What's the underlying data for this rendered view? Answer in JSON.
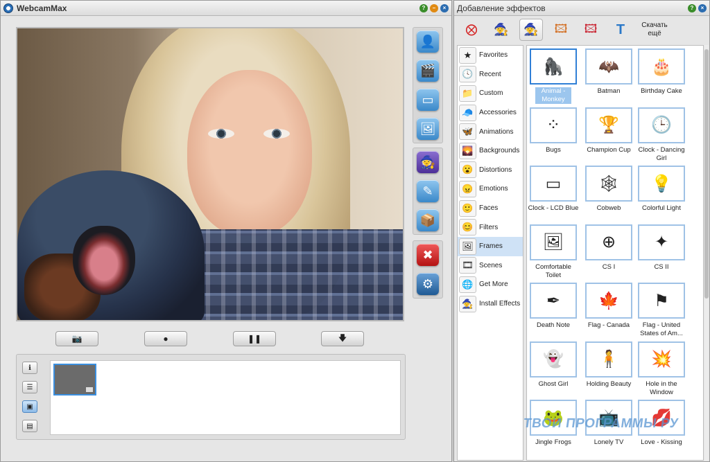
{
  "main_window": {
    "title": "WebcamMax",
    "controls": [
      "help-icon",
      "minimize-icon",
      "close-icon"
    ],
    "side_buttons": [
      {
        "name": "effects-button",
        "icon": "person-icon",
        "glyph": "👤"
      },
      {
        "name": "movie-button",
        "icon": "film-icon",
        "glyph": "🎬"
      },
      {
        "name": "screen-button",
        "icon": "window-icon",
        "glyph": "▭"
      },
      {
        "name": "picture-button",
        "icon": "picture-in-picture-icon",
        "glyph": "🖼"
      },
      {
        "name": "magic-button",
        "icon": "wizard-hat-icon",
        "glyph": "🧙"
      },
      {
        "name": "draw-button",
        "icon": "pencil-icon",
        "glyph": "✎"
      },
      {
        "name": "package-button",
        "icon": "box-icon",
        "glyph": "📦"
      },
      {
        "name": "disable-button",
        "icon": "red-x-icon",
        "glyph": "✖"
      },
      {
        "name": "settings-button",
        "icon": "gear-icon",
        "glyph": "⚙"
      }
    ],
    "control_buttons": [
      {
        "name": "snapshot-button",
        "icon": "camera-icon",
        "glyph": "📷"
      },
      {
        "name": "record-button",
        "icon": "record-dot-icon",
        "glyph": "●"
      },
      {
        "name": "pause-button",
        "icon": "pause-icon",
        "glyph": "❚❚"
      },
      {
        "name": "download-button",
        "icon": "down-arrow-icon",
        "glyph": "🡇"
      }
    ],
    "mode_buttons": [
      {
        "name": "info-mode-button",
        "icon": "info-icon",
        "glyph": "ℹ",
        "active": false
      },
      {
        "name": "list-mode-button",
        "icon": "list-icon",
        "glyph": "☰",
        "active": false
      },
      {
        "name": "picture-mode-button",
        "icon": "picture-icon",
        "glyph": "▣",
        "active": true
      },
      {
        "name": "video-mode-button",
        "icon": "film-strip-icon",
        "glyph": "▤",
        "active": false
      }
    ]
  },
  "effects_window": {
    "title": "Добавление эффектов",
    "toolbar_download_label": "Скачать ещё",
    "toolbar": [
      {
        "name": "remove-effect-button",
        "icon": "red-x-icon",
        "glyph": "⨂",
        "color": "#d42020"
      },
      {
        "name": "magic-hat-button",
        "icon": "wizard-hat-icon",
        "glyph": "🧙",
        "color": "#5b2fa0"
      },
      {
        "name": "wizard-button",
        "icon": "wizard-icon",
        "glyph": "🧙",
        "color": "#2a8a6e"
      },
      {
        "name": "add-effect-button",
        "icon": "add-photo-icon",
        "glyph": "🖾",
        "color": "#d26a1c"
      },
      {
        "name": "edit-effect-button",
        "icon": "edit-photo-icon",
        "glyph": "🖾",
        "color": "#c81e2c"
      },
      {
        "name": "text-effect-button",
        "icon": "text-icon",
        "glyph": "T",
        "color": "#2a78c8"
      }
    ],
    "categories": [
      {
        "label": "Favorites",
        "icon": "star-icon",
        "glyph": "★"
      },
      {
        "label": "Recent",
        "icon": "clock-icon",
        "glyph": "🕓"
      },
      {
        "label": "Custom",
        "icon": "folder-icon",
        "glyph": "📁"
      },
      {
        "label": "Accessories",
        "icon": "cap-icon",
        "glyph": "🧢"
      },
      {
        "label": "Animations",
        "icon": "butterfly-icon",
        "glyph": "🦋"
      },
      {
        "label": "Backgrounds",
        "icon": "landscape-icon",
        "glyph": "🌄"
      },
      {
        "label": "Distortions",
        "icon": "face-icon",
        "glyph": "😮"
      },
      {
        "label": "Emotions",
        "icon": "face-icon",
        "glyph": "😠"
      },
      {
        "label": "Faces",
        "icon": "face-icon",
        "glyph": "🙂"
      },
      {
        "label": "Filters",
        "icon": "face-icon",
        "glyph": "😊"
      },
      {
        "label": "Frames",
        "icon": "frame-icon",
        "glyph": "🖼",
        "active": true
      },
      {
        "label": "Scenes",
        "icon": "scene-icon",
        "glyph": "🎞"
      },
      {
        "label": "Get More",
        "icon": "globe-icon",
        "glyph": "🌐"
      },
      {
        "label": "Install Effects",
        "icon": "wizard-hat-icon",
        "glyph": "🧙"
      }
    ],
    "effects": [
      {
        "label": "Animal - Monkey",
        "icon": "monkey-icon",
        "glyph": "🦍",
        "selected": true
      },
      {
        "label": "Batman",
        "icon": "bat-icon",
        "glyph": "🦇"
      },
      {
        "label": "Birthday Cake",
        "icon": "cake-icon",
        "glyph": "🎂"
      },
      {
        "label": "Bugs",
        "icon": "bugs-icon",
        "glyph": "⁘"
      },
      {
        "label": "Champion Cup",
        "icon": "cup-icon",
        "glyph": "🏆"
      },
      {
        "label": "Clock - Dancing Girl",
        "icon": "clock-icon",
        "glyph": "🕒"
      },
      {
        "label": "Clock - LCD Blue",
        "icon": "lcd-icon",
        "glyph": "▭"
      },
      {
        "label": "Cobweb",
        "icon": "cobweb-icon",
        "glyph": "🕸"
      },
      {
        "label": "Colorful Light",
        "icon": "light-icon",
        "glyph": "💡"
      },
      {
        "label": "Comfortable Toilet",
        "icon": "frame-icon",
        "glyph": "🖼"
      },
      {
        "label": "CS I",
        "icon": "crosshair-icon",
        "glyph": "⊕"
      },
      {
        "label": "CS II",
        "icon": "gun-icon",
        "glyph": "✦"
      },
      {
        "label": "Death Note",
        "icon": "note-icon",
        "glyph": "✒"
      },
      {
        "label": "Flag - Canada",
        "icon": "canada-flag-icon",
        "glyph": "🍁"
      },
      {
        "label": "Flag - United States of Am...",
        "icon": "us-flag-icon",
        "glyph": "⚑"
      },
      {
        "label": "Ghost Girl",
        "icon": "ghost-icon",
        "glyph": "👻"
      },
      {
        "label": "Holding Beauty",
        "icon": "person-icon",
        "glyph": "🧍"
      },
      {
        "label": "Hole in the Window",
        "icon": "crack-icon",
        "glyph": "💥"
      },
      {
        "label": "Jingle Frogs",
        "icon": "frog-icon",
        "glyph": "🐸"
      },
      {
        "label": "Lonely TV",
        "icon": "tv-icon",
        "glyph": "📺"
      },
      {
        "label": "Love - Kissing",
        "icon": "kiss-icon",
        "glyph": "💋"
      }
    ],
    "watermark": "ТВОИ ПРОГРАММЫ РУ"
  }
}
